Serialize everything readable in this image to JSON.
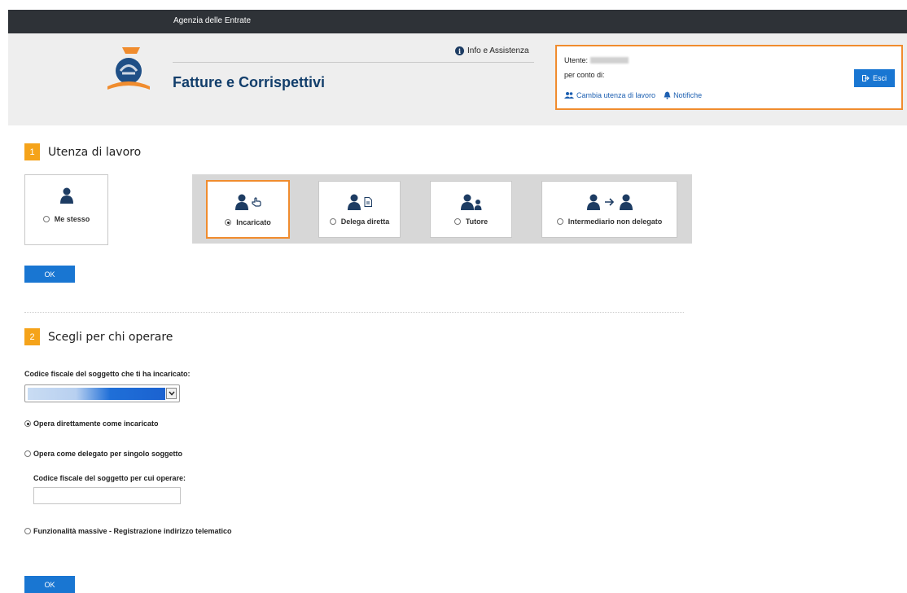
{
  "topbar": {
    "title": "Agenzia delle Entrate"
  },
  "header": {
    "app_title": "Fatture e Corrispettivi",
    "info_link": "Info e Assistenza"
  },
  "user_box": {
    "utente_label": "Utente:",
    "per_conto_label": "per conto di:",
    "cambia_utenza": "Cambia utenza di lavoro",
    "notifiche": "Notifiche",
    "esci": "Esci"
  },
  "step1": {
    "number": "1",
    "title": "Utenza di lavoro",
    "options": [
      {
        "label": "Me stesso",
        "selected": false,
        "icon": "user-icon"
      },
      {
        "label": "Incaricato",
        "selected": true,
        "icon": "user-hand-icon"
      },
      {
        "label": "Delega diretta",
        "selected": false,
        "icon": "user-document-icon"
      },
      {
        "label": "Tutore",
        "selected": false,
        "icon": "user-pair-icon"
      },
      {
        "label": "Intermediario non delegato",
        "selected": false,
        "icon": "user-arrow-user-icon"
      }
    ],
    "ok_label": "OK"
  },
  "step2": {
    "number": "2",
    "title": "Scegli per chi operare",
    "codice_label": "Codice fiscale del soggetto che ti ha incaricato:",
    "radio_options": [
      {
        "label": "Opera direttamente come incaricato",
        "selected": true
      },
      {
        "label": "Opera come delegato per singolo soggetto",
        "selected": false
      },
      {
        "label": "Funzionalità massive - Registrazione indirizzo telematico",
        "selected": false
      }
    ],
    "codice_operare_label": "Codice fiscale del soggetto per cui operare:",
    "ok_label": "OK"
  },
  "colors": {
    "accent_orange": "#f08c2e",
    "step_badge": "#f5a31a",
    "primary_blue": "#1976d2",
    "dark_navy": "#123e6b",
    "topbar": "#2e3237"
  }
}
